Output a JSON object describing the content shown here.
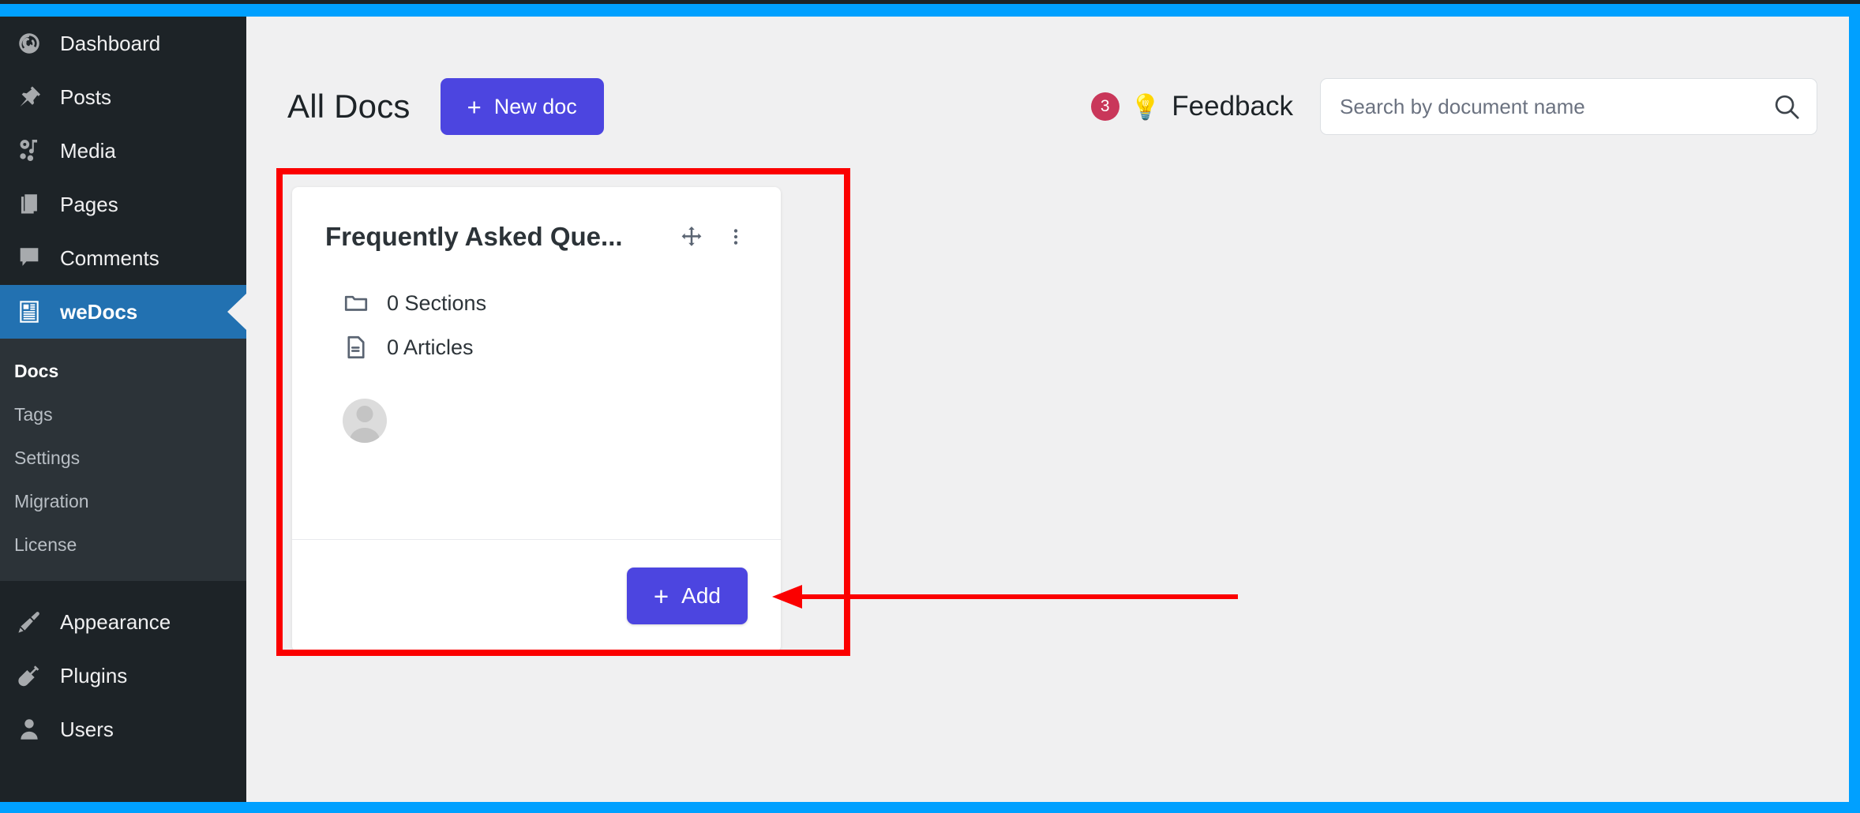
{
  "theme": {
    "frame_color": "#00a0ff",
    "sidebar_bg": "#1d2327",
    "sidebar_active_bg": "#2271b1",
    "submenu_bg": "#2c3338",
    "accent_purple": "#4c45e0",
    "badge_red": "#c9375a",
    "annotation_red": "#fb0000",
    "content_bg": "#f0f0f1"
  },
  "sidebar": {
    "items": [
      {
        "label": "Dashboard",
        "icon": "dashboard-icon",
        "active": false
      },
      {
        "label": "Posts",
        "icon": "pin-icon",
        "active": false
      },
      {
        "label": "Media",
        "icon": "media-icon",
        "active": false
      },
      {
        "label": "Pages",
        "icon": "pages-icon",
        "active": false
      },
      {
        "label": "Comments",
        "icon": "comment-icon",
        "active": false
      },
      {
        "label": "weDocs",
        "icon": "wedocs-icon",
        "active": true
      }
    ],
    "submenu": [
      {
        "label": "Docs",
        "current": true
      },
      {
        "label": "Tags",
        "current": false
      },
      {
        "label": "Settings",
        "current": false
      },
      {
        "label": "Migration",
        "current": false
      },
      {
        "label": "License",
        "current": false
      }
    ],
    "items_bottom": [
      {
        "label": "Appearance",
        "icon": "brush-icon"
      },
      {
        "label": "Plugins",
        "icon": "plug-icon"
      },
      {
        "label": "Users",
        "icon": "user-icon"
      }
    ]
  },
  "topbar": {
    "title": "All Docs",
    "new_doc_label": "New doc",
    "new_doc_plus": "+",
    "feedback": {
      "badge_count": "3",
      "bulb": "💡",
      "label": "Feedback"
    },
    "search": {
      "value": "",
      "placeholder": "Search by document name"
    }
  },
  "doc_card": {
    "title": "Frequently Asked Que...",
    "move_icon": "move-handle-icon",
    "more_icon": "more-vertical-icon",
    "stats": [
      {
        "icon": "folder-icon",
        "label": "0 Sections"
      },
      {
        "icon": "file-icon",
        "label": "0 Articles"
      }
    ],
    "avatar": "user-avatar",
    "add_label": "Add",
    "add_plus": "+"
  },
  "annotations": {
    "highlight_rect": "red-highlight-rectangle",
    "arrow": "red-arrow-pointing-to-add-button"
  }
}
